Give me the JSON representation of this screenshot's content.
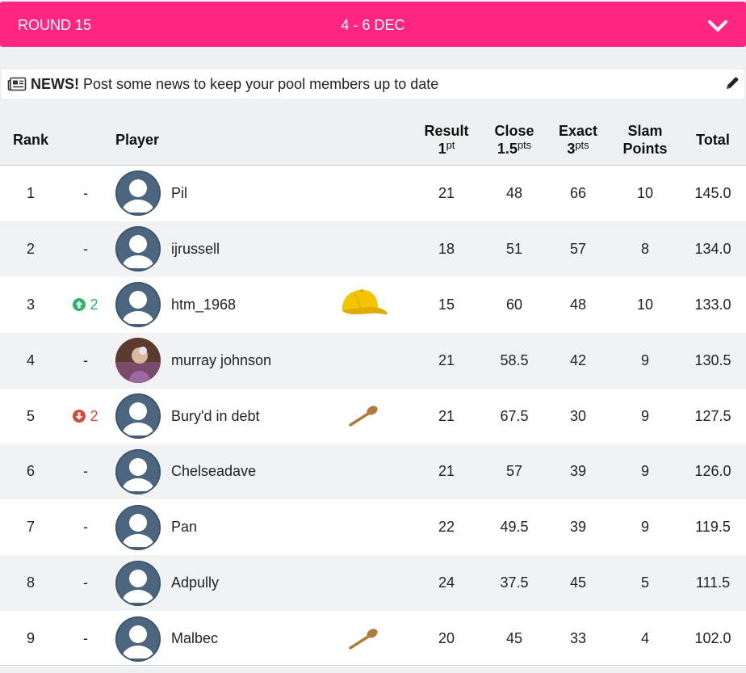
{
  "round": {
    "title": "ROUND 15",
    "dates": "4 - 6 DEC"
  },
  "news": {
    "label": "NEWS!",
    "text": "Post some news to keep your pool members up to date"
  },
  "columns": {
    "rank": "Rank",
    "player": "Player",
    "result": "Result",
    "result_unit": "1",
    "result_sup": "pt",
    "close": "Close",
    "close_unit": "1.5",
    "close_sup": "pts",
    "exact": "Exact",
    "exact_unit": "3",
    "exact_sup": "pts",
    "slam": "Slam",
    "slam2": "Points",
    "total": "Total"
  },
  "colors": {
    "accent": "#ff2681",
    "up": "#2fb36b",
    "down": "#d9463a"
  },
  "rows": [
    {
      "rank": "1",
      "move": "-",
      "trend": "none",
      "avatar": "default-avatar",
      "name": "Pil",
      "badge": "",
      "result": "21",
      "close": "48",
      "exact": "66",
      "slam": "10",
      "total": "145.0"
    },
    {
      "rank": "2",
      "move": "-",
      "trend": "none",
      "avatar": "default-avatar",
      "name": "ijrussell",
      "badge": "",
      "result": "18",
      "close": "51",
      "exact": "57",
      "slam": "8",
      "total": "134.0"
    },
    {
      "rank": "3",
      "move": "2",
      "trend": "up",
      "avatar": "default-avatar",
      "name": "htm_1968",
      "badge": "cap-icon",
      "result": "15",
      "close": "60",
      "exact": "48",
      "slam": "10",
      "total": "133.0"
    },
    {
      "rank": "4",
      "move": "-",
      "trend": "none",
      "avatar": "photo-avatar",
      "name": "murray johnson",
      "badge": "",
      "result": "21",
      "close": "58.5",
      "exact": "42",
      "slam": "9",
      "total": "130.5"
    },
    {
      "rank": "5",
      "move": "2",
      "trend": "down",
      "avatar": "default-avatar",
      "name": "Bury'd in debt",
      "badge": "wooden-spoon-icon",
      "result": "21",
      "close": "67.5",
      "exact": "30",
      "slam": "9",
      "total": "127.5"
    },
    {
      "rank": "6",
      "move": "-",
      "trend": "none",
      "avatar": "default-avatar",
      "name": "Chelseadave",
      "badge": "",
      "result": "21",
      "close": "57",
      "exact": "39",
      "slam": "9",
      "total": "126.0"
    },
    {
      "rank": "7",
      "move": "-",
      "trend": "none",
      "avatar": "default-avatar",
      "name": "Pan",
      "badge": "",
      "result": "22",
      "close": "49.5",
      "exact": "39",
      "slam": "9",
      "total": "119.5"
    },
    {
      "rank": "8",
      "move": "-",
      "trend": "none",
      "avatar": "default-avatar",
      "name": "Adpully",
      "badge": "",
      "result": "24",
      "close": "37.5",
      "exact": "45",
      "slam": "5",
      "total": "111.5"
    },
    {
      "rank": "9",
      "move": "-",
      "trend": "none",
      "avatar": "default-avatar",
      "name": "Malbec",
      "badge": "wooden-spoon-icon",
      "result": "20",
      "close": "45",
      "exact": "33",
      "slam": "4",
      "total": "102.0"
    }
  ]
}
